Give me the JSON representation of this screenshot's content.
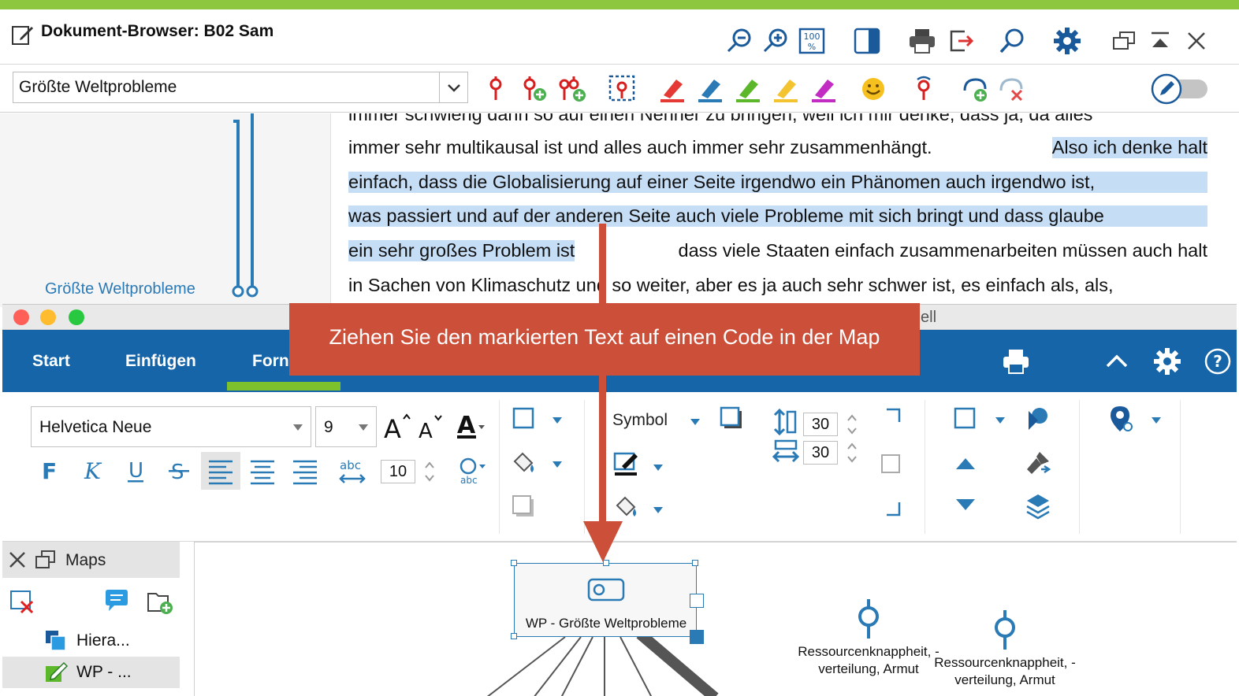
{
  "doc_browser": {
    "title": "Dokument-Browser: B02 Sam",
    "code_select_value": "Größte Weltprobleme",
    "left_code_label": "Größte Weltprobleme",
    "lines": [
      {
        "parts": [
          "immer schwierig dann so auf einen Nenner zu bringen, weil ich mir denke, dass ja, da alles"
        ]
      },
      {
        "plain": "immer sehr multikausal ist und alles auch immer sehr zusammenhängt.",
        "hl": "Also ich denke halt"
      },
      {
        "hl": "einfach, dass die Globalisierung auf einer Seite irgendwo ein Phänomen auch irgendwo ist,"
      },
      {
        "hl": "was passiert und auf der anderen Seite auch viele Probleme mit sich bringt und dass glaube"
      },
      {
        "hl": "ein sehr großes Problem ist",
        "plain": "dass viele Staaten einfach zusammenarbeiten müssen auch halt"
      },
      {
        "plain": "in Sachen von Klimaschutz und so weiter, aber es ja auch sehr schwer ist, es einfach als, als,"
      }
    ]
  },
  "maps_window": {
    "titlebar_text": "ell",
    "tabs": [
      "Start",
      "Einfügen",
      "Forn"
    ],
    "font_family": "Helvetica Neue",
    "font_size": "9",
    "spacing_value": "10",
    "symbol_label": "Symbol",
    "width_value": "30",
    "height_value": "30",
    "panel_title": "Maps",
    "panel_items": [
      "Hiera...",
      "WP - ..."
    ],
    "node_label": "WP - Größte Weltprobleme",
    "code_nodes": [
      "Ressourcenknappheit, -\nverteilung, Armut",
      "Ressourcenknappheit, -\nverteilung, Armut"
    ]
  },
  "hint": {
    "text": "Ziehen Sie den markierten Text auf einen Code in der Map"
  },
  "colors": {
    "accent_green": "#8dc63f",
    "ribbon_blue": "#1565a8",
    "hint_red": "#cb4f39",
    "highlight": "#c6ddf6",
    "code_blue": "#2a7ab6"
  }
}
